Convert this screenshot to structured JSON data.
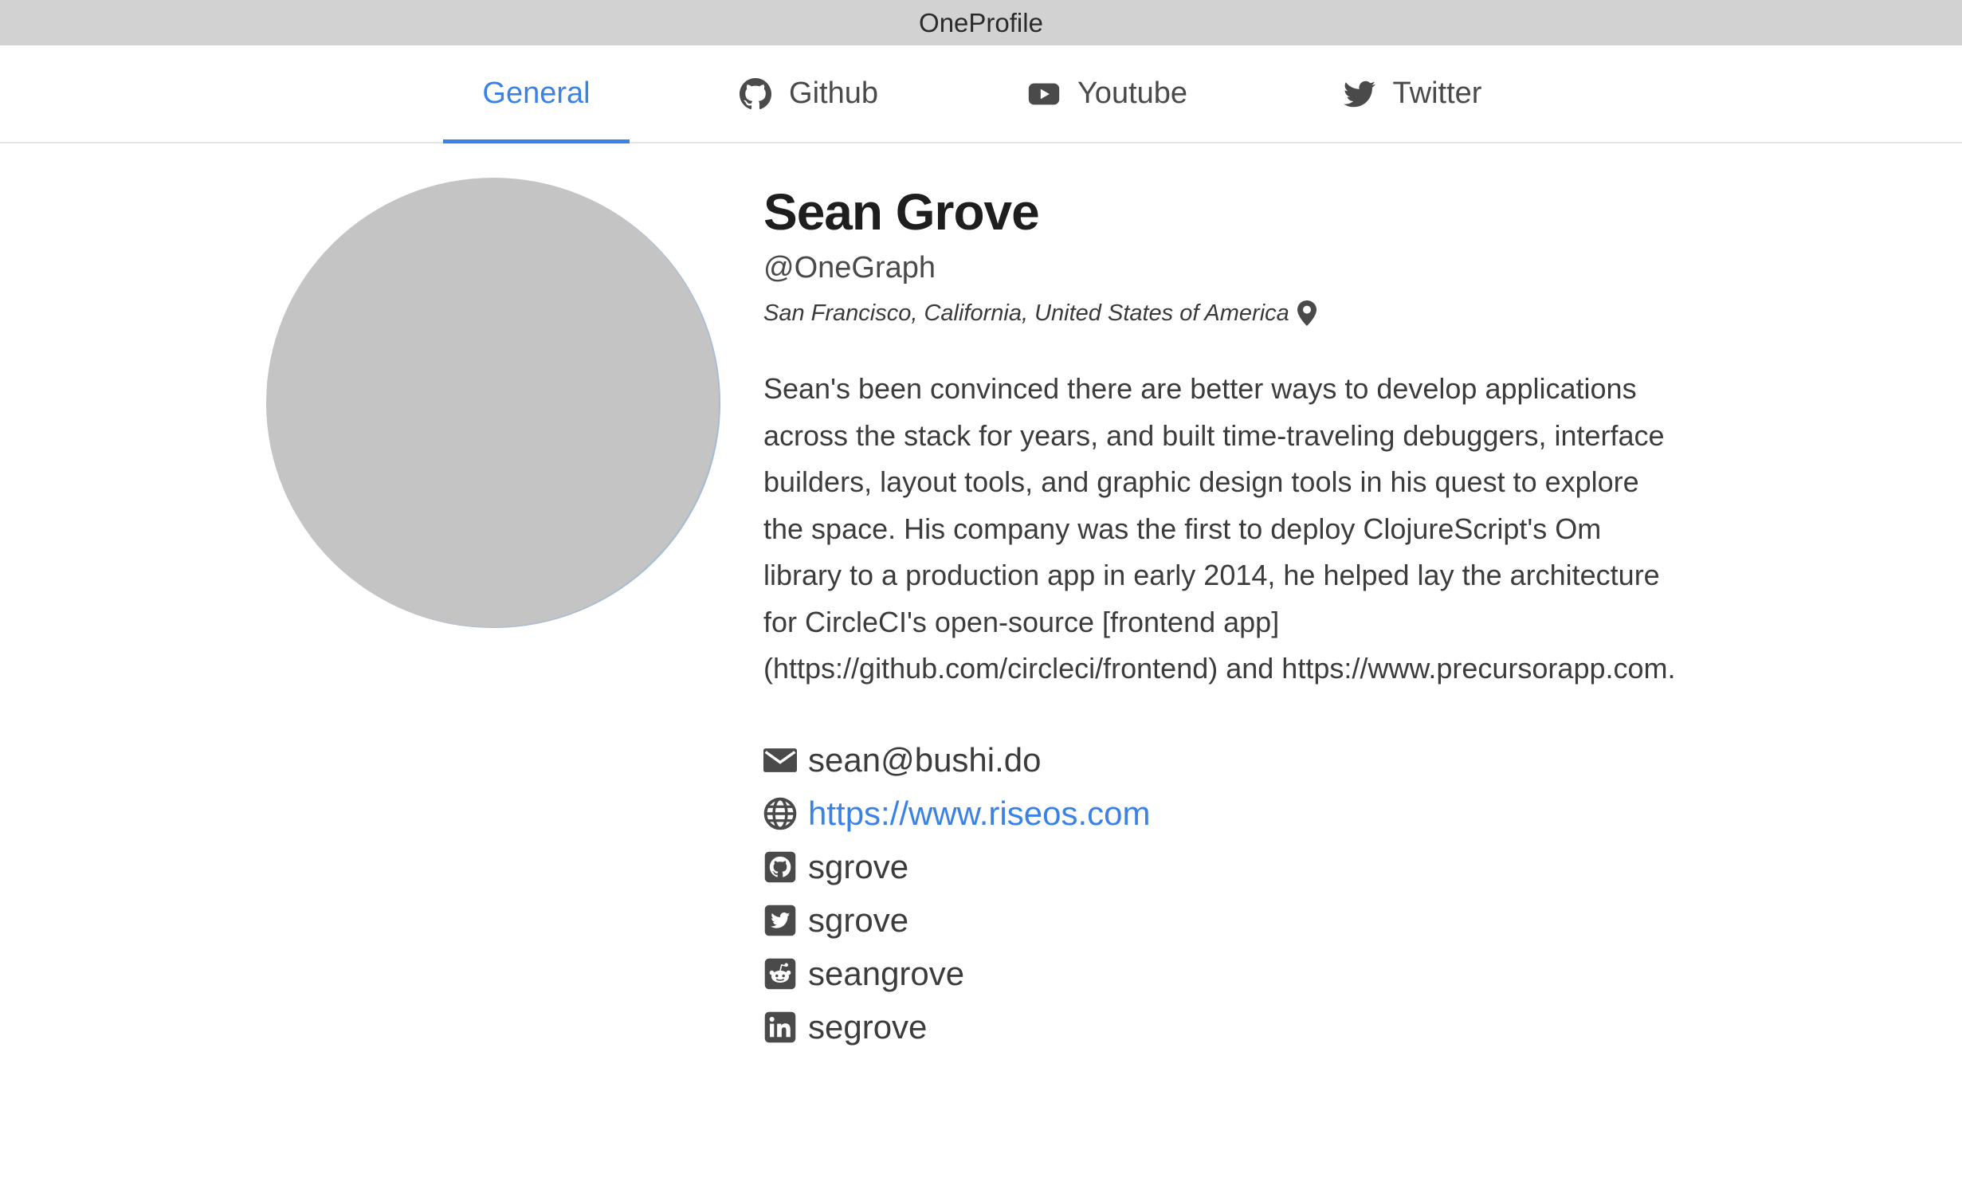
{
  "window": {
    "title": "OneProfile"
  },
  "tabs": [
    {
      "label": "General",
      "active": true,
      "icon": "none"
    },
    {
      "label": "Github",
      "active": false,
      "icon": "github-icon"
    },
    {
      "label": "Youtube",
      "active": false,
      "icon": "youtube-icon"
    },
    {
      "label": "Twitter",
      "active": false,
      "icon": "twitter-icon"
    }
  ],
  "profile": {
    "name": "Sean Grove",
    "handle": "@OneGraph",
    "location": "San Francisco, California, United States of America",
    "bio": "Sean's been convinced there are better ways to develop applications across the stack for years, and built time-traveling debuggers, interface builders, layout tools, and graphic design tools in his quest to explore the space. His company was the first to deploy ClojureScript's Om library to a production app in early 2014, he helped lay the architecture for CircleCI's open-source [frontend app](https://github.com/circleci/frontend) and https://www.precursorapp.com.",
    "contacts": {
      "email": "sean@bushi.do",
      "website": "https://www.riseos.com",
      "github": "sgrove",
      "twitter": "sgrove",
      "reddit": "seangrove",
      "linkedin": "segrove"
    }
  },
  "colors": {
    "accent": "#3a82e6",
    "titlebar": "#d2d2d2",
    "avatar": "#c4c4c4",
    "text": "#3c3c3c"
  }
}
